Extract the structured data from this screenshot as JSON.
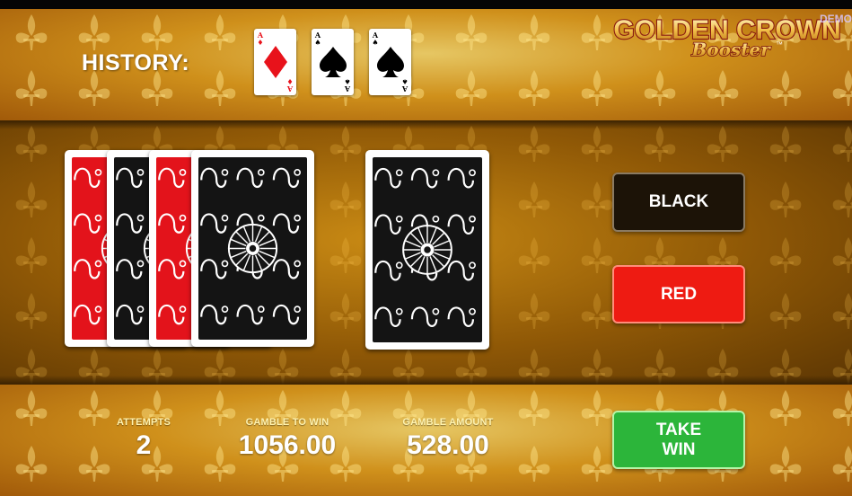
{
  "header": {
    "history_label": "HISTORY:",
    "demo_label": "DEMO",
    "logo": {
      "line1": "GOLDEN CROWN",
      "line2": "Booster",
      "trademark": "™"
    }
  },
  "history": [
    {
      "rank": "A",
      "suit": "diamond",
      "color": "#e8121b"
    },
    {
      "rank": "A",
      "suit": "spade",
      "color": "#000000"
    },
    {
      "rank": "A",
      "suit": "spade",
      "color": "#000000"
    }
  ],
  "deck": {
    "backs": [
      {
        "pattern_color": "#e3131b"
      },
      {
        "pattern_color": "#141414"
      },
      {
        "pattern_color": "#e3131b"
      },
      {
        "pattern_color": "#141414"
      }
    ],
    "current_card": {
      "pattern_color": "#141414"
    }
  },
  "buttons": {
    "black": "BLACK",
    "red": "RED",
    "take_win_line1": "TAKE",
    "take_win_line2": "WIN"
  },
  "stats": {
    "attempts_label": "ATTEMPTS",
    "attempts_value": "2",
    "gamble_to_win_label": "GAMBLE TO WIN",
    "gamble_to_win_value": "1056.00",
    "gamble_amount_label": "GAMBLE AMOUNT",
    "gamble_amount_value": "528.00"
  },
  "colors": {
    "gold": "#e8a21c",
    "button_black": "#1c1307",
    "button_red": "#ee1b12",
    "button_green": "#2cb53a"
  }
}
